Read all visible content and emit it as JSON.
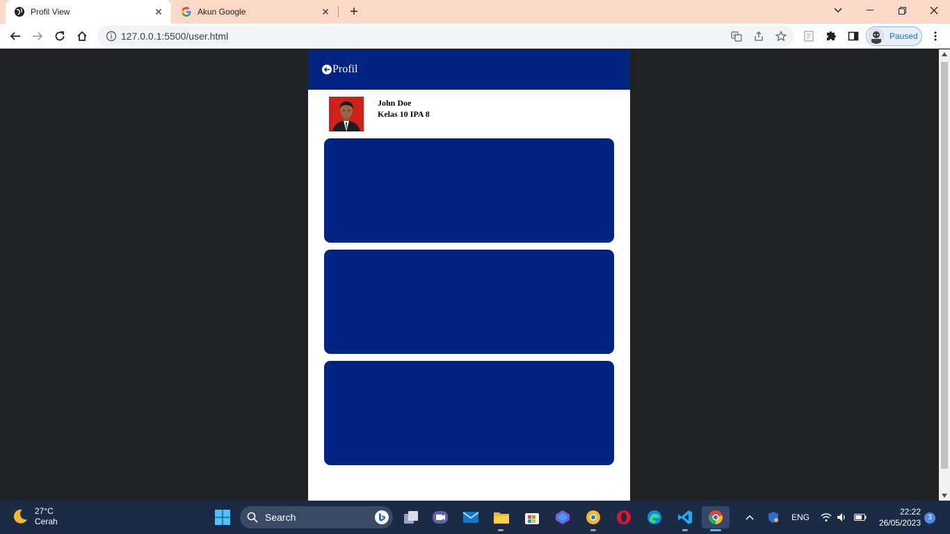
{
  "browser": {
    "tabs": [
      {
        "title": "Profil View",
        "active": true
      },
      {
        "title": "Akun Google",
        "active": false
      }
    ],
    "url": "127.0.0.1:5500/user.html",
    "profile_status": "Paused"
  },
  "app": {
    "header_title": "Profil",
    "user": {
      "name": "John Doe",
      "class": "Kelas 10 IPA 8"
    },
    "card_count": 3
  },
  "taskbar": {
    "weather_temp": "27°C",
    "weather_desc": "Cerah",
    "search_label": "Search",
    "language": "ENG",
    "time": "22:22",
    "date": "26/05/2023",
    "notification_count": "3"
  },
  "colors": {
    "brand_blue": "#002481",
    "tabbar_bg": "#fbd9c8",
    "page_bg": "#202124",
    "photo_bg": "#d0201c"
  }
}
